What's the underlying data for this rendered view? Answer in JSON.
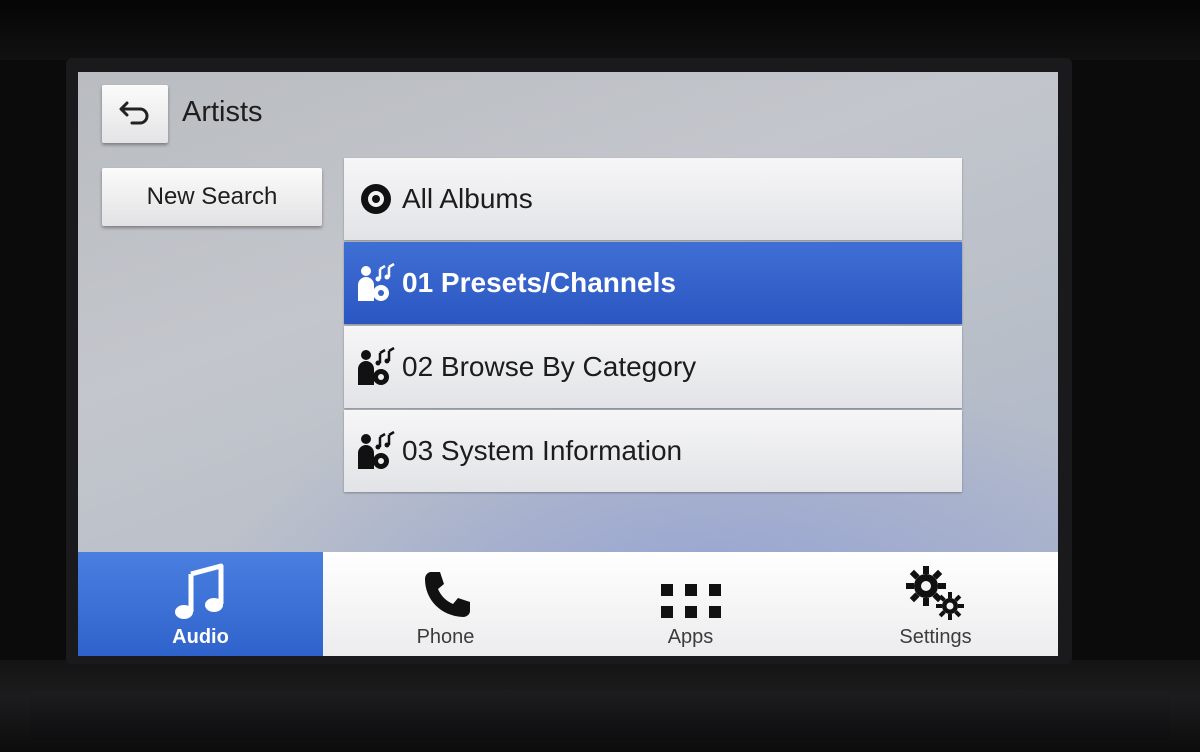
{
  "screen": {
    "title": "Artists"
  },
  "icons": {
    "back": "back-arrow-icon",
    "album": "disc-icon",
    "artist": "artist-music-icon"
  },
  "sidebar": {
    "new_search_label": "New Search"
  },
  "list": {
    "items": [
      {
        "label": "All Albums",
        "icon": "disc-icon",
        "selected": false
      },
      {
        "label": "01 Presets/Channels",
        "icon": "artist-music-icon",
        "selected": true
      },
      {
        "label": "02 Browse By Category",
        "icon": "artist-music-icon",
        "selected": false
      },
      {
        "label": "03 System Information",
        "icon": "artist-music-icon",
        "selected": false
      }
    ]
  },
  "tabbar": {
    "tabs": [
      {
        "label": "Audio",
        "icon": "music-note-icon",
        "active": true
      },
      {
        "label": "Phone",
        "icon": "phone-icon",
        "active": false
      },
      {
        "label": "Apps",
        "icon": "apps-grid-icon",
        "active": false
      },
      {
        "label": "Settings",
        "icon": "gears-icon",
        "active": false
      }
    ]
  },
  "colors": {
    "accent": "#2f63cc",
    "selected_row": "#3563cb",
    "text_dark": "#1e1e1e"
  }
}
